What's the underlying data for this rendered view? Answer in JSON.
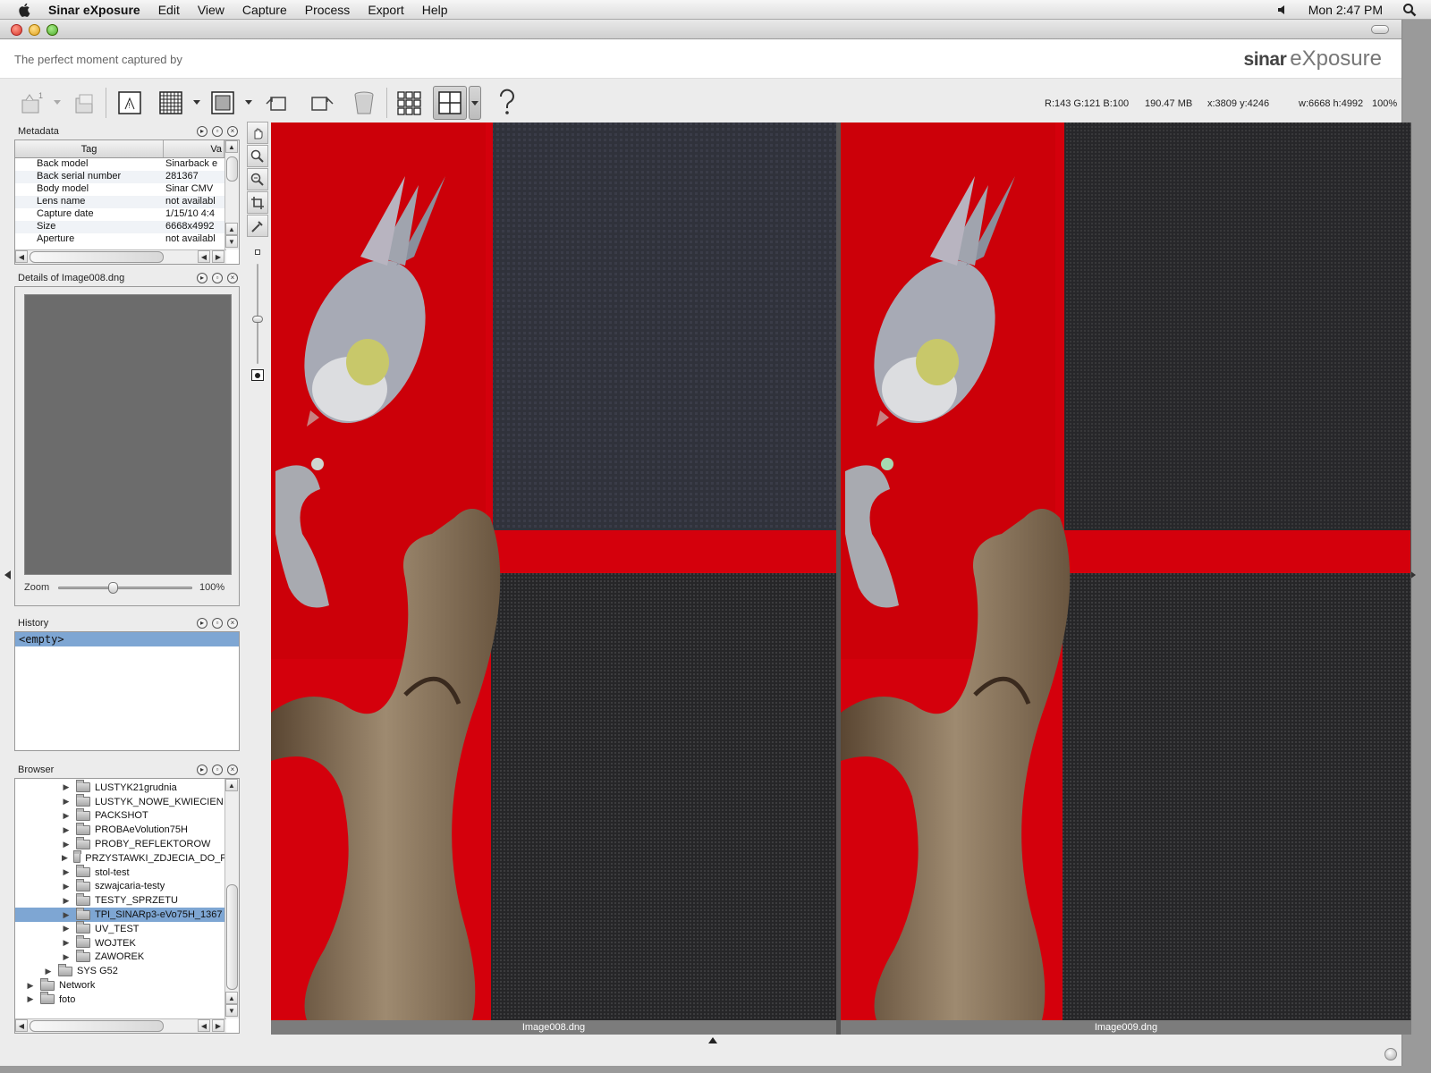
{
  "menubar": {
    "app_name": "Sinar eXposure",
    "menus": [
      "Edit",
      "View",
      "Capture",
      "Process",
      "Export",
      "Help"
    ],
    "clock": "Mon 2:47 PM"
  },
  "header": {
    "tagline": "The perfect moment captured by",
    "brand_bold": "sinar",
    "brand_light": "eXposure"
  },
  "status": {
    "rgb": "R:143 G:121 B:100",
    "memory": "190.47 MB",
    "coords": "x:3809 y:4246",
    "size": "w:6668 h:4992",
    "zoom": "100%"
  },
  "metadata": {
    "title": "Metadata",
    "col_tag": "Tag",
    "col_value": "Va",
    "rows": [
      {
        "tag": "Back model",
        "value": "Sinarback e"
      },
      {
        "tag": "Back serial number",
        "value": "281367"
      },
      {
        "tag": "Body model",
        "value": "Sinar CMV"
      },
      {
        "tag": "Lens name",
        "value": "not availabl"
      },
      {
        "tag": "Capture date",
        "value": "1/15/10 4:4"
      },
      {
        "tag": "Size",
        "value": "6668x4992"
      },
      {
        "tag": "Aperture",
        "value": "not availabl"
      }
    ]
  },
  "details": {
    "title": "Details of Image008.dng",
    "zoom_label": "Zoom",
    "zoom_value": "100%",
    "zoom_level": 0.4
  },
  "history": {
    "title": "History",
    "items": [
      "<empty>"
    ]
  },
  "browser": {
    "title": "Browser",
    "items": [
      {
        "label": "LUSTYK21grudnia",
        "depth": 2
      },
      {
        "label": "LUSTYK_NOWE_KWIECIEN",
        "depth": 2
      },
      {
        "label": "PACKSHOT",
        "depth": 2
      },
      {
        "label": "PROBAeVolution75H",
        "depth": 2
      },
      {
        "label": "PROBY_REFLEKTOROW",
        "depth": 2
      },
      {
        "label": "PRZYSTAWKI_ZDJECIA_DO_F",
        "depth": 2
      },
      {
        "label": "stol-test",
        "depth": 2
      },
      {
        "label": "szwajcaria-testy",
        "depth": 2
      },
      {
        "label": "TESTY_SPRZETU",
        "depth": 2
      },
      {
        "label": "TPI_SINARp3-eVo75H_1367",
        "depth": 2,
        "selected": true
      },
      {
        "label": "UV_TEST",
        "depth": 2
      },
      {
        "label": "WOJTEK",
        "depth": 2
      },
      {
        "label": "ZAWOREK",
        "depth": 2
      },
      {
        "label": "SYS G52",
        "depth": 1
      },
      {
        "label": "Network",
        "depth": 0
      },
      {
        "label": "foto",
        "depth": 0
      }
    ]
  },
  "viewer": {
    "left_image": "Image008.dng",
    "right_image": "Image009.dng"
  },
  "colors": {
    "selection": "#7ea6d3",
    "background_red": "#d4000c"
  }
}
